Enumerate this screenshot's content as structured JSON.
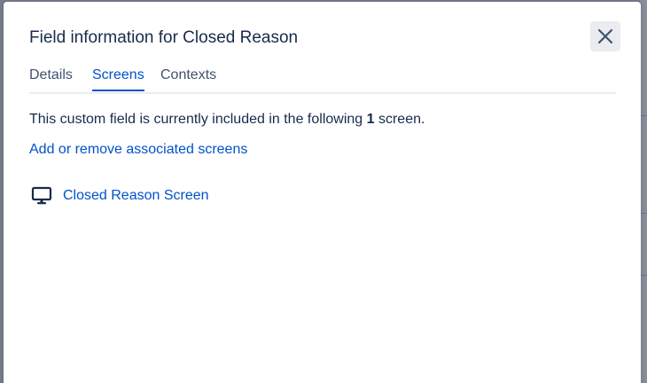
{
  "dialog": {
    "title": "Field information for Closed Reason",
    "close_icon": "close-icon"
  },
  "tabs": [
    {
      "label": "Details",
      "active": false
    },
    {
      "label": "Screens",
      "active": true
    },
    {
      "label": "Contexts",
      "active": false
    }
  ],
  "screens_panel": {
    "description_prefix": "This custom field is currently included in the following ",
    "count": "1",
    "description_suffix": " screen.",
    "associate_link": "Add or remove associated screens",
    "screens": [
      {
        "name": "Closed Reason Screen",
        "icon": "monitor-icon"
      }
    ]
  },
  "colors": {
    "accent": "#0052cc",
    "text": "#172b4d",
    "tab_inactive": "#42526e",
    "overlay": "#7a7f8a"
  }
}
